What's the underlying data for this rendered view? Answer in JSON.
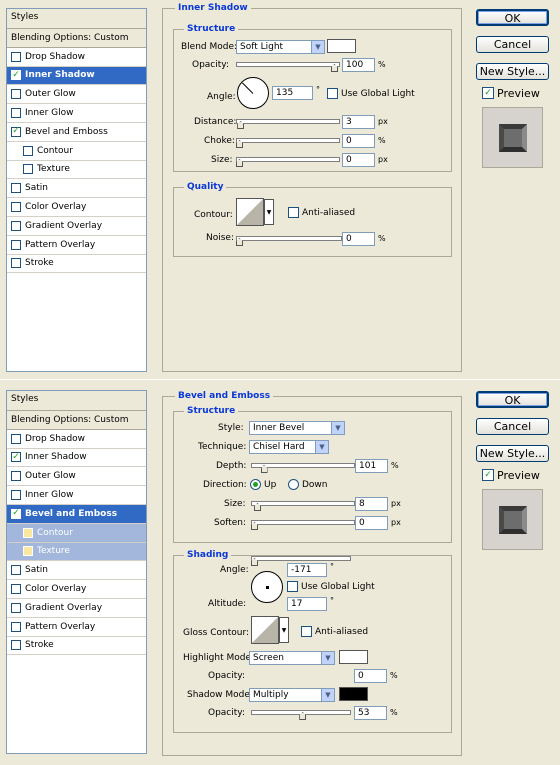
{
  "panel1": {
    "sidebar": {
      "title": "Styles",
      "items": [
        {
          "label": "Blending Options: Custom",
          "checkbox": false,
          "checked": false,
          "indent": false,
          "state": "first"
        },
        {
          "label": "Drop Shadow",
          "checkbox": true,
          "checked": false,
          "indent": false,
          "state": ""
        },
        {
          "label": "Inner Shadow",
          "checkbox": true,
          "checked": true,
          "indent": false,
          "state": "sel"
        },
        {
          "label": "Outer Glow",
          "checkbox": true,
          "checked": false,
          "indent": false,
          "state": ""
        },
        {
          "label": "Inner Glow",
          "checkbox": true,
          "checked": false,
          "indent": false,
          "state": ""
        },
        {
          "label": "Bevel and Emboss",
          "checkbox": true,
          "checked": true,
          "indent": false,
          "state": ""
        },
        {
          "label": "Contour",
          "checkbox": true,
          "checked": false,
          "indent": true,
          "state": ""
        },
        {
          "label": "Texture",
          "checkbox": true,
          "checked": false,
          "indent": true,
          "state": ""
        },
        {
          "label": "Satin",
          "checkbox": true,
          "checked": false,
          "indent": false,
          "state": ""
        },
        {
          "label": "Color Overlay",
          "checkbox": true,
          "checked": false,
          "indent": false,
          "state": ""
        },
        {
          "label": "Gradient Overlay",
          "checkbox": true,
          "checked": false,
          "indent": false,
          "state": ""
        },
        {
          "label": "Pattern Overlay",
          "checkbox": true,
          "checked": false,
          "indent": false,
          "state": ""
        },
        {
          "label": "Stroke",
          "checkbox": true,
          "checked": false,
          "indent": false,
          "state": ""
        }
      ]
    },
    "section_title": "Inner Shadow",
    "structure_title": "Structure",
    "blend_mode_label": "Blend Mode:",
    "blend_mode_value": "Soft Light",
    "blend_color": "#ffffff",
    "opacity_label": "Opacity:",
    "opacity_value": "100",
    "opacity_level": 1.0,
    "opacity_unit": "%",
    "angle_label": "Angle:",
    "angle_value": "135",
    "angle_unit": "°",
    "use_global_light_label": "Use Global Light",
    "distance_label": "Distance:",
    "distance_value": "3",
    "distance_level": 0.012,
    "distance_unit": "px",
    "choke_label": "Choke:",
    "choke_value": "0",
    "choke_level": 0,
    "choke_unit": "%",
    "size_label": "Size:",
    "size_value": "0",
    "size_level": 0,
    "size_unit": "px",
    "quality_title": "Quality",
    "contour_label": "Contour:",
    "anti_aliased_label": "Anti-aliased",
    "noise_label": "Noise:",
    "noise_value": "0",
    "noise_level": 0,
    "noise_unit": "%",
    "buttons": {
      "ok": "OK",
      "cancel": "Cancel",
      "new_style": "New Style...",
      "preview": "Preview"
    }
  },
  "panel2": {
    "sidebar": {
      "title": "Styles",
      "items": [
        {
          "label": "Blending Options: Custom",
          "checkbox": false,
          "checked": false,
          "indent": false,
          "state": "first"
        },
        {
          "label": "Drop Shadow",
          "checkbox": true,
          "checked": false,
          "indent": false,
          "state": ""
        },
        {
          "label": "Inner Shadow",
          "checkbox": true,
          "checked": true,
          "indent": false,
          "state": ""
        },
        {
          "label": "Outer Glow",
          "checkbox": true,
          "checked": false,
          "indent": false,
          "state": ""
        },
        {
          "label": "Inner Glow",
          "checkbox": true,
          "checked": false,
          "indent": false,
          "state": ""
        },
        {
          "label": "Bevel and Emboss",
          "checkbox": true,
          "checked": true,
          "indent": false,
          "state": "sel"
        },
        {
          "label": "Contour",
          "checkbox": true,
          "checked": false,
          "indent": true,
          "state": "subsel"
        },
        {
          "label": "Texture",
          "checkbox": true,
          "checked": false,
          "indent": true,
          "state": "subsel"
        },
        {
          "label": "Satin",
          "checkbox": true,
          "checked": false,
          "indent": false,
          "state": ""
        },
        {
          "label": "Color Overlay",
          "checkbox": true,
          "checked": false,
          "indent": false,
          "state": ""
        },
        {
          "label": "Gradient Overlay",
          "checkbox": true,
          "checked": false,
          "indent": false,
          "state": ""
        },
        {
          "label": "Pattern Overlay",
          "checkbox": true,
          "checked": false,
          "indent": false,
          "state": ""
        },
        {
          "label": "Stroke",
          "checkbox": true,
          "checked": false,
          "indent": false,
          "state": ""
        }
      ]
    },
    "section_title": "Bevel and Emboss",
    "structure_title": "Structure",
    "style_label": "Style:",
    "style_value": "Inner Bevel",
    "technique_label": "Technique:",
    "technique_value": "Chisel Hard",
    "depth_label": "Depth:",
    "depth_value": "101",
    "depth_level": 0.1,
    "depth_unit": "%",
    "direction_label": "Direction:",
    "direction_up": "Up",
    "direction_down": "Down",
    "size_label": "Size:",
    "size_value": "8",
    "size_level": 0.032,
    "size_unit": "px",
    "soften_label": "Soften:",
    "soften_value": "0",
    "soften_level": 0,
    "soften_unit": "px",
    "shading_title": "Shading",
    "angle_label": "Angle:",
    "angle_value": "-171",
    "angle_unit": "°",
    "use_global_light_label": "Use Global Light",
    "altitude_label": "Altitude:",
    "altitude_value": "17",
    "altitude_unit": "°",
    "gloss_contour_label": "Gloss Contour:",
    "anti_aliased_label": "Anti-aliased",
    "highlight_mode_label": "Highlight Mode:",
    "highlight_mode_value": "Screen",
    "highlight_color": "#ffffff",
    "h_opacity_label": "Opacity:",
    "h_opacity_value": "0",
    "h_opacity_level": 0,
    "h_opacity_unit": "%",
    "shadow_mode_label": "Shadow Mode:",
    "shadow_mode_value": "Multiply",
    "shadow_color": "#000000",
    "s_opacity_label": "Opacity:",
    "s_opacity_value": "53",
    "s_opacity_level": 0.53,
    "s_opacity_unit": "%",
    "buttons": {
      "ok": "OK",
      "cancel": "Cancel",
      "new_style": "New Style...",
      "preview": "Preview"
    }
  }
}
